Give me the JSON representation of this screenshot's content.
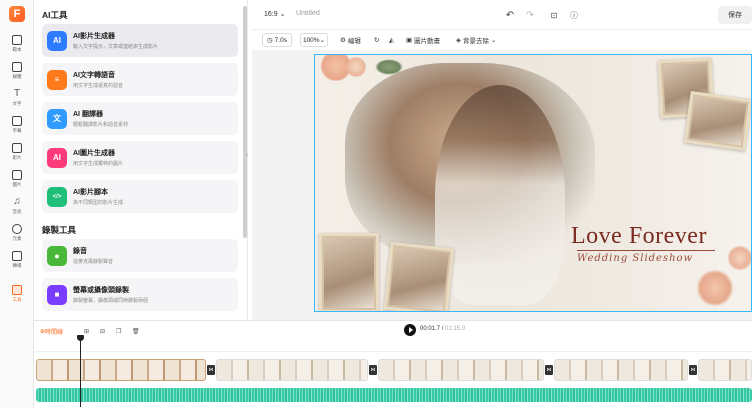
{
  "app": {
    "logo_letter": "F"
  },
  "rail": {
    "items": [
      {
        "label": "範本",
        "icon": "template-icon"
      },
      {
        "label": "媒體",
        "icon": "media-icon"
      },
      {
        "label": "文字",
        "icon": "text-icon"
      },
      {
        "label": "字幕",
        "icon": "subtitle-icon"
      },
      {
        "label": "影片",
        "icon": "video-icon"
      },
      {
        "label": "圖片",
        "icon": "image-icon"
      },
      {
        "label": "音訊",
        "icon": "audio-icon"
      },
      {
        "label": "元素",
        "icon": "elements-icon"
      },
      {
        "label": "轉場",
        "icon": "transition-icon"
      },
      {
        "label": "工具",
        "icon": "tools-icon",
        "active": true
      }
    ]
  },
  "panel": {
    "ai_section_title": "AI工具",
    "record_section_title": "錄製工具",
    "ai_tools": [
      {
        "title": "AI影片生成器",
        "desc": "輸入文字提示，文章或連結來生成影片",
        "color": "#2f7bff",
        "glyph": "AI"
      },
      {
        "title": "AI文字轉語音",
        "desc": "用文字生成逼真的語音",
        "color": "#ff7a1a",
        "glyph": "≡"
      },
      {
        "title": "AI 翻譯器",
        "desc": "輕鬆翻譯影片和語音素材",
        "color": "#2f9bff",
        "glyph": "文"
      },
      {
        "title": "AI圖片生成器",
        "desc": "用文字生成獨特的圖片",
        "color": "#ff3a7a",
        "glyph": "AI"
      },
      {
        "title": "AI影片腳本",
        "desc": "為不同類型的影片生成",
        "color": "#1fbf7a",
        "glyph": "</>"
      }
    ],
    "record_tools": [
      {
        "title": "錄音",
        "desc": "從麥克風錄製聲音",
        "color": "#49b83a",
        "glyph": "🎤"
      },
      {
        "title": "螢幕或攝像頭錄製",
        "desc": "錄製螢幕，攝像頭或同時錄製兩個",
        "color": "#7a3cff",
        "glyph": "■"
      }
    ]
  },
  "topbar": {
    "aspect_ratio": "16:9",
    "project_title": "Untitled",
    "save_label": "保存"
  },
  "toolbar": {
    "duration": "7.0s",
    "zoom": "100%",
    "edit_label": "编辑",
    "animation_label": "圖片動畫",
    "bg_remove_label": "背景去除"
  },
  "canvas": {
    "headline": "Love Forever",
    "subline": "Wedding Slideshow",
    "colors": {
      "selection": "#3ab8ff",
      "headline": "#7a2a1f"
    }
  },
  "timeline": {
    "split_label": "時間線",
    "current_time": "00:01.7",
    "total_time": "01:15.0",
    "transition_labels": [
      "S2"
    ]
  }
}
